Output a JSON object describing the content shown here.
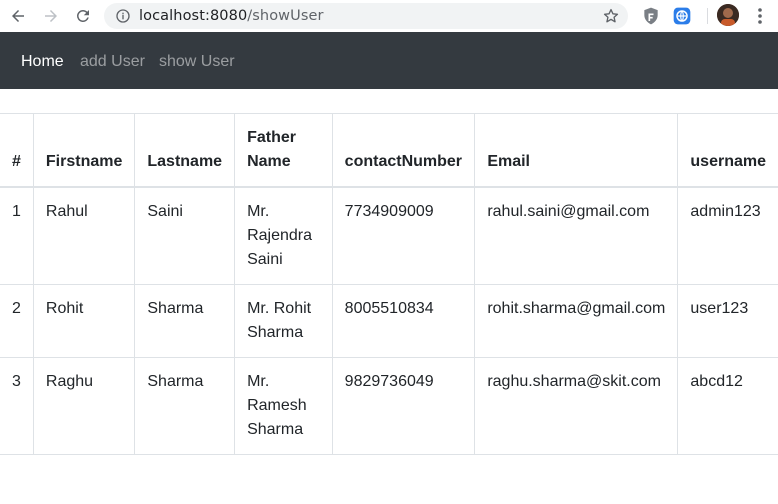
{
  "browser": {
    "url_host": "localhost:8080",
    "url_path": "/showUser"
  },
  "navbar": {
    "items": [
      {
        "label": "Home",
        "active": true
      },
      {
        "label": "add User",
        "active": false
      },
      {
        "label": "show User",
        "active": false
      }
    ]
  },
  "table": {
    "headers": [
      "#",
      "Firstname",
      "Lastname",
      "Father Name",
      "contactNumber",
      "Email",
      "username"
    ],
    "rows": [
      [
        "1",
        "Rahul",
        "Saini",
        "Mr. Rajendra Saini",
        "7734909009",
        "rahul.saini@gmail.com",
        "admin123"
      ],
      [
        "2",
        "Rohit",
        "Sharma",
        "Mr. Rohit Sharma",
        "8005510834",
        "rohit.sharma@gmail.com",
        "user123"
      ],
      [
        "3",
        "Raghu",
        "Sharma",
        "Mr. Ramesh Sharma",
        "9829736049",
        "raghu.sharma@skit.com",
        "abcd12"
      ]
    ]
  },
  "colors": {
    "navbar_bg": "#343a40",
    "border": "#dee2e6",
    "text": "#212529"
  }
}
